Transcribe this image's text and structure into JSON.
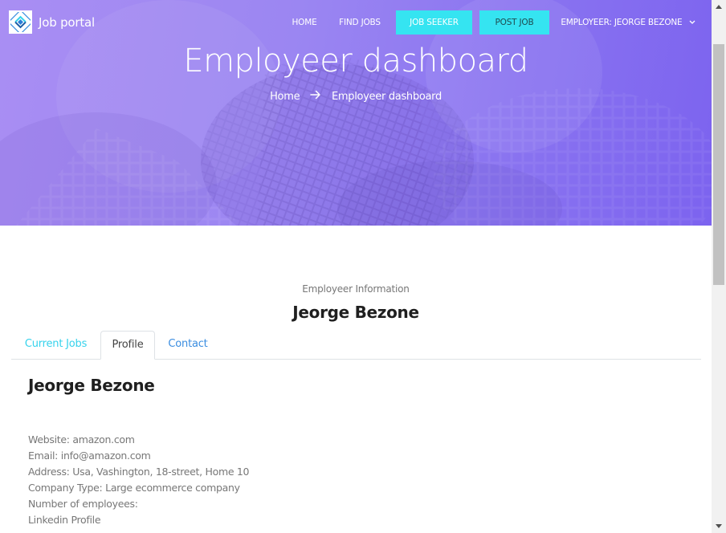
{
  "header": {
    "logo_text": "Job portal",
    "nav": {
      "home": "HOME",
      "find_jobs": "FIND JOBS",
      "job_seeker": "JOB SEEKER",
      "post_job": "POST JOB",
      "employer_menu": "EMPLOYEER: JEORGE BEZONE"
    },
    "colors": {
      "hero_gradient_start": "#a98ef3",
      "hero_gradient_end": "#7c63ef",
      "nav_button_bg": "#35e4f1"
    }
  },
  "hero": {
    "title": "Employeer dashboard",
    "breadcrumb": {
      "home": "Home",
      "current": "Employeer dashboard"
    }
  },
  "section": {
    "kicker": "Employeer Information",
    "name": "Jeorge Bezone"
  },
  "tabs": {
    "current_jobs": "Current Jobs",
    "profile": "Profile",
    "contact": "Contact",
    "active": "Profile"
  },
  "profile": {
    "name": "Jeorge Bezone",
    "details": [
      {
        "label": "Website:",
        "value": "amazon.com"
      },
      {
        "label": "Email:",
        "value": "info@amazon.com"
      },
      {
        "label": "Address:",
        "value": "Usa, Vashington, 18-street, Home 10"
      },
      {
        "label": "Company Type:",
        "value": "Large ecommerce company"
      },
      {
        "label": "Number of employees:",
        "value": ""
      },
      {
        "label": "Linkedin Profile",
        "value": ""
      }
    ]
  }
}
